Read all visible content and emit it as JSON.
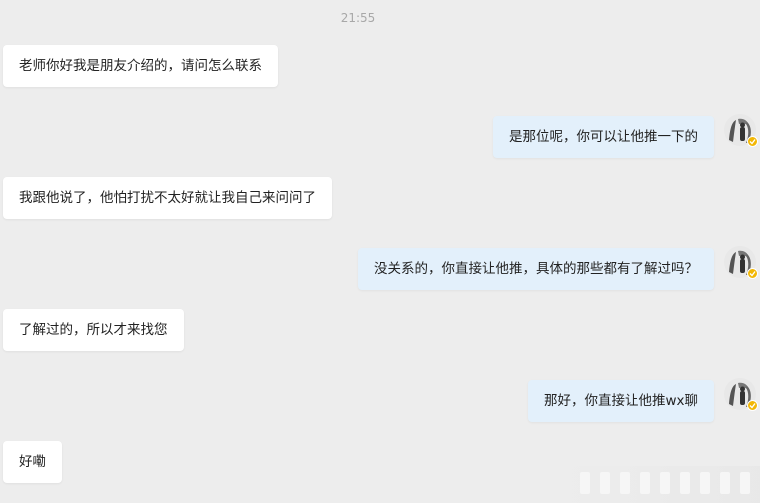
{
  "chat": {
    "timestamp": "21:55",
    "messages": [
      {
        "side": "left",
        "text": "老师你好我是朋友介绍的，请问怎么联系"
      },
      {
        "side": "right",
        "text": "是那位呢，你可以让他推一下的"
      },
      {
        "side": "left",
        "text": "我跟他说了，他怕打扰不太好就让我自己来问问了"
      },
      {
        "side": "right",
        "text": "没关系的，你直接让他推，具体的那些都有了解过吗？"
      },
      {
        "side": "left",
        "text": "了解过的，所以才来找您"
      },
      {
        "side": "right",
        "text": "那好，你直接让他推wx聊"
      },
      {
        "side": "left",
        "text": "好嘞"
      }
    ]
  },
  "colors": {
    "background": "#ededed",
    "incoming_bubble": "#ffffff",
    "outgoing_bubble": "#e3f0fb",
    "badge": "#f2b705"
  },
  "icons": {
    "avatar": "user-avatar-icon",
    "badge": "verified-badge-icon"
  }
}
